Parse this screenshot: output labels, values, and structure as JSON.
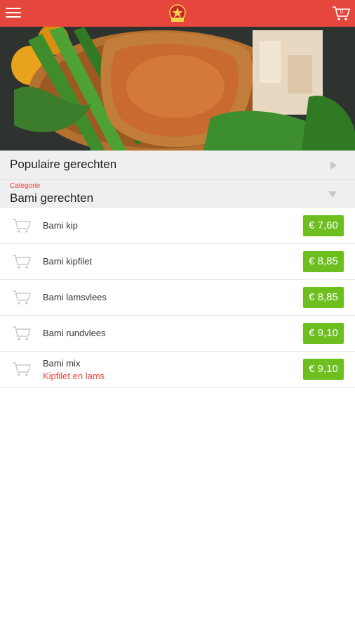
{
  "header": {
    "menu_icon": "hamburger-menu-icon",
    "logo_icon": "restaurant-logo",
    "cart_icon": "cart-icon",
    "cart_count": "0",
    "accent_color": "#e5473d"
  },
  "popular": {
    "title": "Populaire gerechten",
    "icon": "chevron-right-icon"
  },
  "category": {
    "label": "Categorie",
    "value": "Bami gerechten",
    "icon": "chevron-down-icon"
  },
  "items": [
    {
      "name": "Bami kip",
      "subtitle": "",
      "price": "€ 7,60"
    },
    {
      "name": "Bami kipfilet",
      "subtitle": "",
      "price": "€ 8,85"
    },
    {
      "name": "Bami lamsvlees",
      "subtitle": "",
      "price": "€ 8,85"
    },
    {
      "name": "Bami rundvlees",
      "subtitle": "",
      "price": "€ 9,10"
    },
    {
      "name": "Bami mix",
      "subtitle": "Kipfilet en lams",
      "price": "€ 9,10"
    }
  ],
  "colors": {
    "price_badge": "#6cbf1f",
    "subtitle": "#e5473d"
  }
}
